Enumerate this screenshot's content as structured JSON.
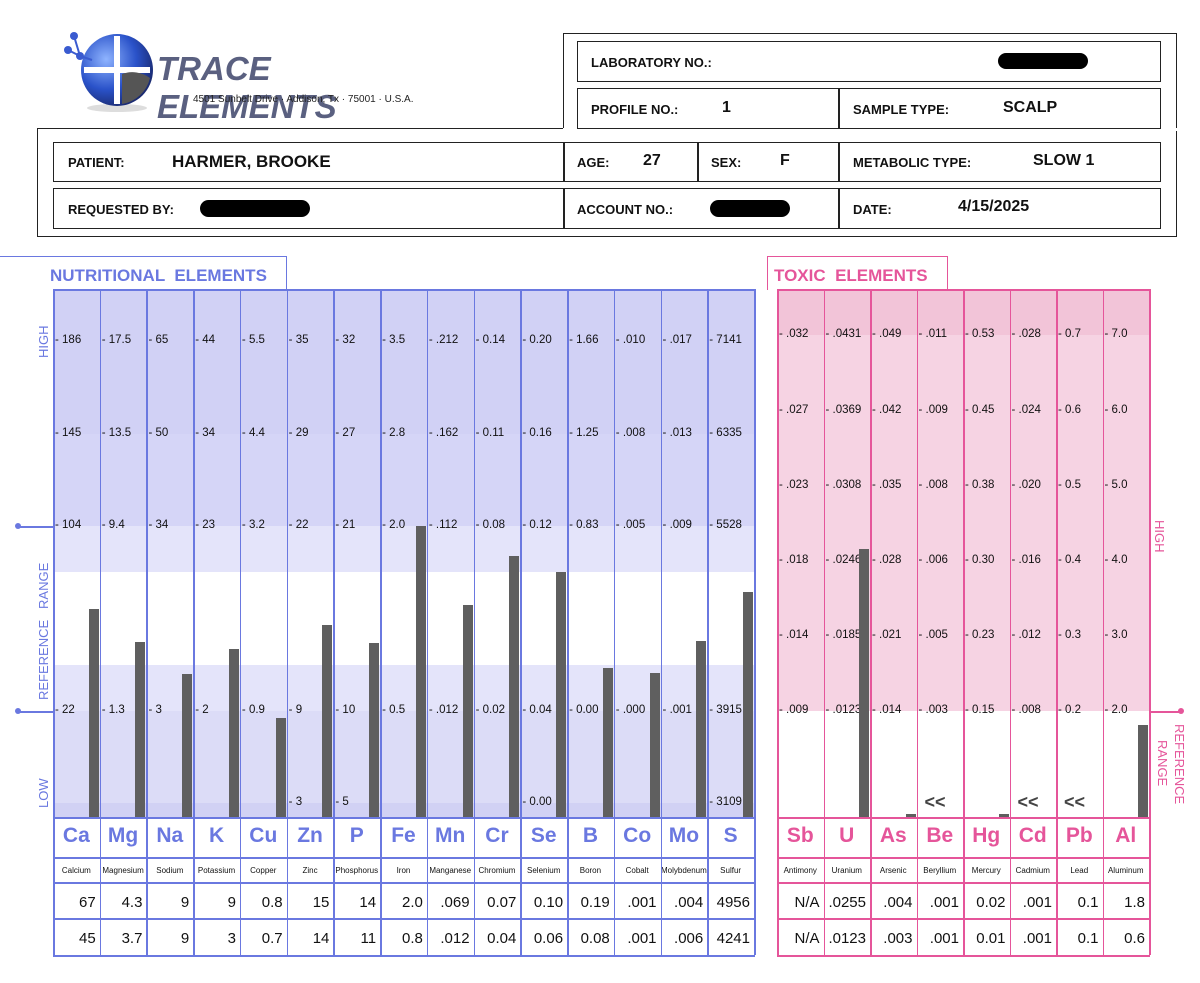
{
  "header": {
    "company": "TRACE ELEMENTS",
    "address": "4501 Sunbelt Drive · Addison, Tx · 75001 · U.S.A.",
    "lab_no_label": "LABORATORY NO.:",
    "profile_label": "PROFILE NO.:",
    "profile_value": "1",
    "sample_type_label": "SAMPLE TYPE:",
    "sample_type": "SCALP",
    "patient_label": "PATIENT:",
    "patient": "HARMER, BROOKE",
    "age_label": "AGE:",
    "age": "27",
    "sex_label": "SEX:",
    "sex": "F",
    "metabolic_label": "METABOLIC TYPE:",
    "metabolic": "SLOW 1",
    "requested_label": "REQUESTED BY:",
    "account_label": "ACCOUNT NO.:",
    "date_label": "DATE:",
    "date": "4/15/2025"
  },
  "colors": {
    "nutritional": "#6a78e0",
    "toxic": "#e5559a",
    "bar": "#5f5f5f"
  },
  "nutritional": {
    "title": "NUTRITIONAL  ELEMENTS",
    "high_label": "HIGH",
    "ref_label": "REFERENCE   RANGE",
    "low_label": "LOW",
    "elements": [
      {
        "symbol": "Ca",
        "name": "Calcium",
        "ticks": [
          "186",
          "145",
          "104",
          "22",
          null
        ],
        "bar": 0.394,
        "row1": "67",
        "row2": "45"
      },
      {
        "symbol": "Mg",
        "name": "Magnesium",
        "ticks": [
          "17.5",
          "13.5",
          "9.4",
          "1.3",
          null
        ],
        "bar": 0.331,
        "row1": "4.3",
        "row2": "3.7"
      },
      {
        "symbol": "Na",
        "name": "Sodium",
        "ticks": [
          "65",
          "50",
          "34",
          "3",
          null
        ],
        "bar": 0.271,
        "row1": "9",
        "row2": "9"
      },
      {
        "symbol": "K",
        "name": "Potassium",
        "ticks": [
          "44",
          "34",
          "23",
          "2",
          null
        ],
        "bar": 0.318,
        "row1": "9",
        "row2": "3"
      },
      {
        "symbol": "Cu",
        "name": "Copper",
        "ticks": [
          "5.5",
          "4.4",
          "3.2",
          "0.9",
          null
        ],
        "bar": 0.188,
        "row1": "0.8",
        "row2": "0.7"
      },
      {
        "symbol": "Zn",
        "name": "Zinc",
        "ticks": [
          "35",
          "29",
          "22",
          "9",
          "3"
        ],
        "bar": 0.364,
        "row1": "15",
        "row2": "14"
      },
      {
        "symbol": "P",
        "name": "Phosphorus",
        "ticks": [
          "32",
          "27",
          "21",
          "10",
          "5"
        ],
        "bar": 0.33,
        "row1": "14",
        "row2": "11"
      },
      {
        "symbol": "Fe",
        "name": "Iron",
        "ticks": [
          "3.5",
          "2.8",
          "2.0",
          "0.5",
          null
        ],
        "bar": 0.551,
        "row1": "2.0",
        "row2": "0.8"
      },
      {
        "symbol": "Mn",
        "name": "Manganese",
        "ticks": [
          ".212",
          ".162",
          ".112",
          ".012",
          null
        ],
        "bar": 0.402,
        "row1": ".069",
        "row2": ".012"
      },
      {
        "symbol": "Cr",
        "name": "Chromium",
        "ticks": [
          "0.14",
          "0.11",
          "0.08",
          "0.02",
          null
        ],
        "bar": 0.494,
        "row1": "0.07",
        "row2": "0.04"
      },
      {
        "symbol": "Se",
        "name": "Selenium",
        "ticks": [
          "0.20",
          "0.16",
          "0.12",
          "0.04",
          "0.00"
        ],
        "bar": 0.464,
        "row1": "0.10",
        "row2": "0.06"
      },
      {
        "symbol": "B",
        "name": "Boron",
        "ticks": [
          "1.66",
          "1.25",
          "0.83",
          "0.00",
          null
        ],
        "bar": 0.282,
        "row1": "0.19",
        "row2": "0.08"
      },
      {
        "symbol": "Co",
        "name": "Cobalt",
        "ticks": [
          ".010",
          ".008",
          ".005",
          ".000",
          null
        ],
        "bar": 0.273,
        "row1": ".001",
        "row2": ".001"
      },
      {
        "symbol": "Mo",
        "name": "Molybdenum",
        "ticks": [
          ".017",
          ".013",
          ".009",
          ".001",
          null
        ],
        "bar": 0.333,
        "row1": ".004",
        "row2": ".006"
      },
      {
        "symbol": "S",
        "name": "Sulfur",
        "ticks": [
          "7141",
          "6335",
          "5528",
          "3915",
          "3109"
        ],
        "bar": 0.426,
        "row1": "4956",
        "row2": "4241"
      }
    ]
  },
  "toxic": {
    "title": "TOXIC  ELEMENTS",
    "high_label": "HIGH",
    "ref_label_1": "REFERENCE",
    "ref_label_2": "RANGE",
    "elements": [
      {
        "symbol": "Sb",
        "name": "Antimony",
        "ticks": [
          ".032",
          ".027",
          ".023",
          ".018",
          ".014",
          ".009"
        ],
        "bar": 0,
        "low_marker": null,
        "row1": "N/A",
        "row2": "N/A"
      },
      {
        "symbol": "U",
        "name": "Uranium",
        "ticks": [
          ".0431",
          ".0369",
          ".0308",
          ".0246",
          ".0185",
          ".0123"
        ],
        "bar": 0.508,
        "low_marker": null,
        "row1": ".0255",
        "row2": ".0123"
      },
      {
        "symbol": "As",
        "name": "Arsenic",
        "ticks": [
          ".049",
          ".042",
          ".035",
          ".028",
          ".021",
          ".014"
        ],
        "bar": 0.006,
        "low_marker": null,
        "row1": ".004",
        "row2": ".003"
      },
      {
        "symbol": "Be",
        "name": "Beryllium",
        "ticks": [
          ".011",
          ".009",
          ".008",
          ".006",
          ".005",
          ".003"
        ],
        "bar": 0,
        "low_marker": "<<",
        "row1": ".001",
        "row2": ".001"
      },
      {
        "symbol": "Hg",
        "name": "Mercury",
        "ticks": [
          "0.53",
          "0.45",
          "0.38",
          "0.30",
          "0.23",
          "0.15"
        ],
        "bar": 0.006,
        "low_marker": null,
        "row1": "0.02",
        "row2": "0.01"
      },
      {
        "symbol": "Cd",
        "name": "Cadmium",
        "ticks": [
          ".028",
          ".024",
          ".020",
          ".016",
          ".012",
          ".008"
        ],
        "bar": 0,
        "low_marker": "<<",
        "row1": ".001",
        "row2": ".001"
      },
      {
        "symbol": "Pb",
        "name": "Lead",
        "ticks": [
          "0.7",
          "0.6",
          "0.5",
          "0.4",
          "0.3",
          "0.2"
        ],
        "bar": 0,
        "low_marker": "<<",
        "row1": "0.1",
        "row2": "0.1"
      },
      {
        "symbol": "Al",
        "name": "Aluminum",
        "ticks": [
          "7.0",
          "6.0",
          "5.0",
          "4.0",
          "3.0",
          "2.0"
        ],
        "bar": 0.174,
        "low_marker": null,
        "row1": "1.8",
        "row2": "0.6"
      }
    ]
  }
}
